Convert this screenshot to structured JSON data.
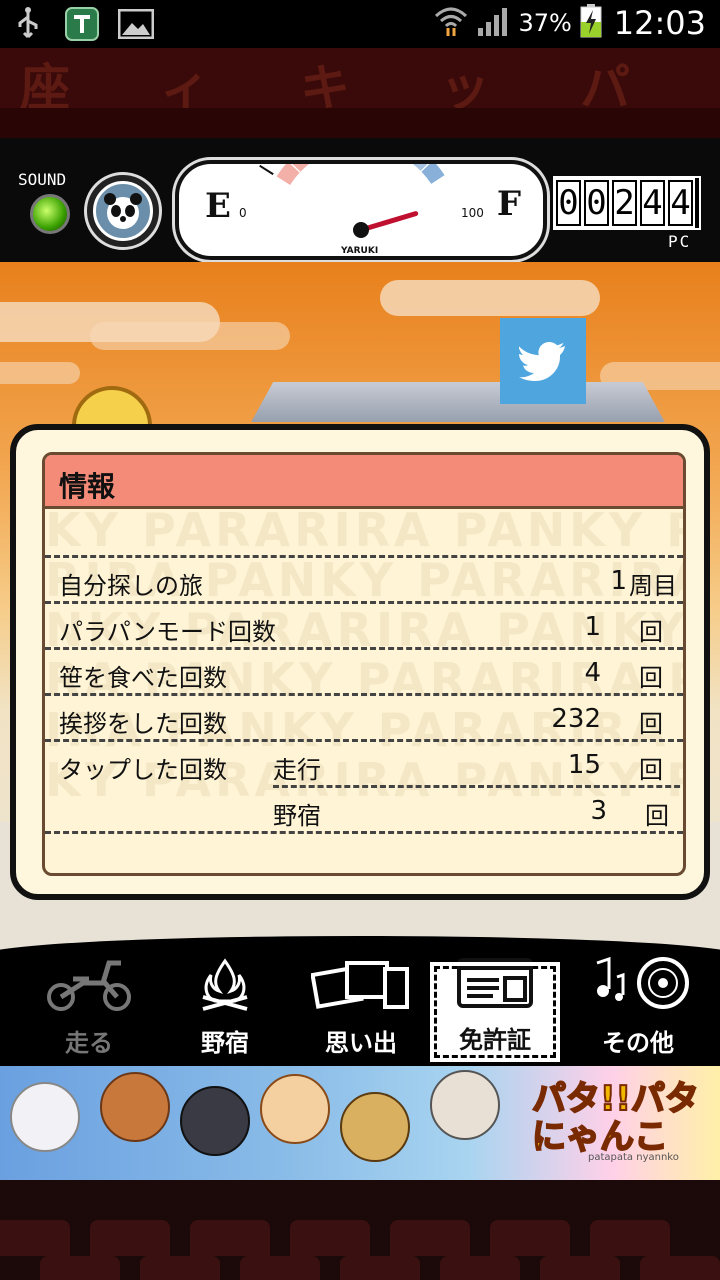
{
  "status_bar": {
    "icons_left": [
      "usb-icon",
      "app-t-icon",
      "image-icon"
    ],
    "battery_percent": "37%",
    "time": "12:03"
  },
  "curtain": {
    "letters": [
      "座",
      "ィ",
      "キ",
      "ッ",
      "パ"
    ]
  },
  "dashboard": {
    "sound_label": "SOUND",
    "gauge": {
      "left_label": "E",
      "right_label": "F",
      "min_label": "0",
      "max_label": "100",
      "caption": "YARUKI",
      "level": 0.72
    },
    "counter_digits": [
      "0",
      "0",
      "2",
      "4",
      "4"
    ],
    "counter_unit": "PC"
  },
  "info_panel": {
    "title": "情報",
    "rows": [
      {
        "label": "自分探しの旅",
        "value": "1",
        "unit": "周目"
      },
      {
        "label": "パラパンモード回数",
        "value": "1",
        "unit": "回"
      },
      {
        "label": "笹を食べた回数",
        "value": "4",
        "unit": "回"
      },
      {
        "label": "挨拶をした回数",
        "value": "232",
        "unit": "回"
      },
      {
        "label": "タップした回数",
        "sub": "走行",
        "value": "15",
        "unit": "回"
      },
      {
        "label": "",
        "sub": "野宿",
        "value": "3",
        "unit": "回"
      }
    ],
    "watermark": [
      "RA PANKY PARARIRA PAN",
      "KY PARARIRA PANKY PARA",
      "RIRA PANKY PARARIRA PA",
      "NKY PARARIRA PANKY PAR",
      "RA PANKY PARARIRA PANK",
      "IRA PANKY PARARIRA PAN",
      "KY PARARIRA PANKY PARA"
    ]
  },
  "nav": {
    "items": [
      {
        "label": "走る",
        "icon": "scooter-icon"
      },
      {
        "label": "野宿",
        "icon": "campfire-icon"
      },
      {
        "label": "思い出",
        "icon": "photos-icon"
      },
      {
        "label": "免許証",
        "icon": "license-card-icon"
      },
      {
        "label": "その他",
        "icon": "music-disc-icon"
      }
    ],
    "active_index": 3
  },
  "banner": {
    "logo_text": "パタ!!パタにゃんこ",
    "logo_sub": "patapata nyannko"
  }
}
